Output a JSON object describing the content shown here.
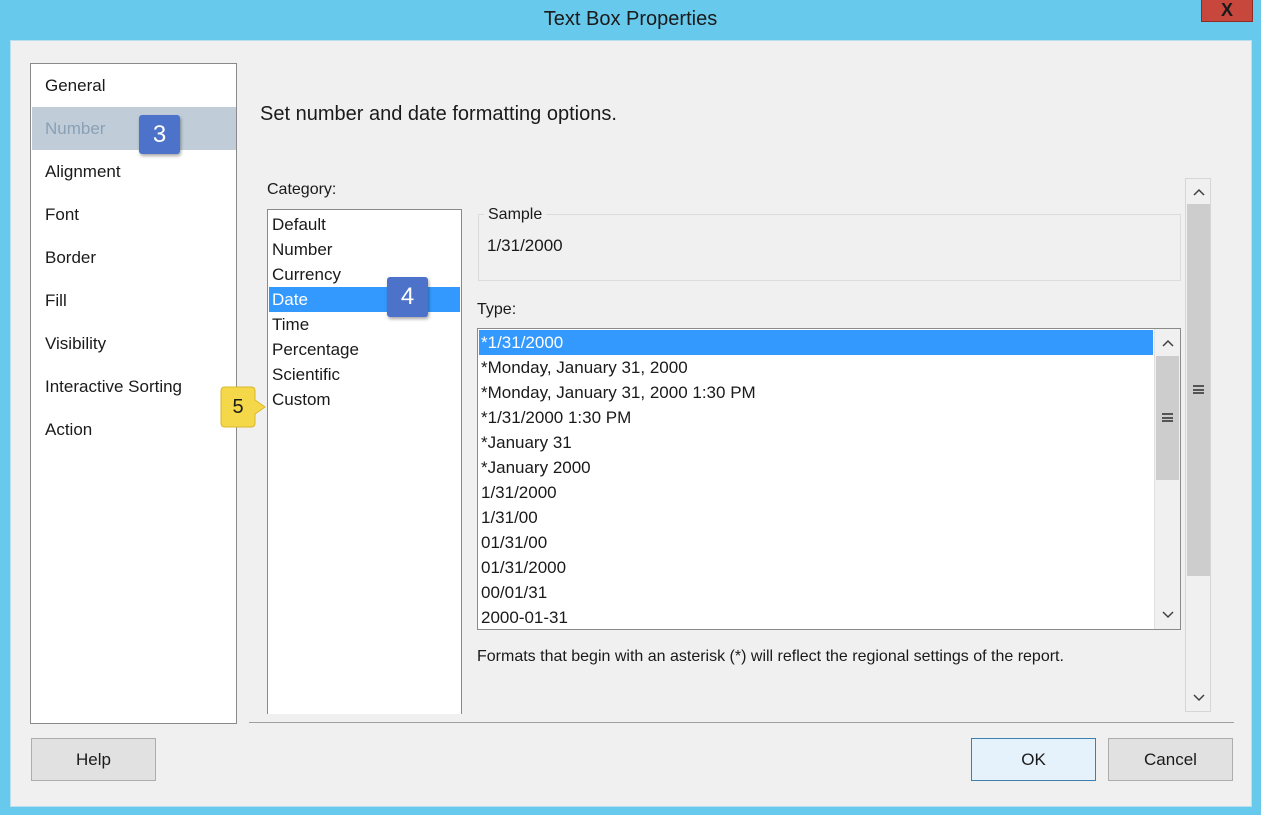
{
  "window": {
    "title": "Text Box Properties",
    "close_label": "X"
  },
  "nav": {
    "items": [
      {
        "label": "General"
      },
      {
        "label": "Number"
      },
      {
        "label": "Alignment"
      },
      {
        "label": "Font"
      },
      {
        "label": "Border"
      },
      {
        "label": "Fill"
      },
      {
        "label": "Visibility"
      },
      {
        "label": "Interactive Sorting"
      },
      {
        "label": "Action"
      }
    ],
    "selected": "Number"
  },
  "callouts": {
    "step3": "3",
    "step4": "4",
    "step5": "5"
  },
  "main": {
    "heading": "Set number and date formatting options.",
    "category_label": "Category:",
    "categories": [
      "Default",
      "Number",
      "Currency",
      "Date",
      "Time",
      "Percentage",
      "Scientific",
      "Custom"
    ],
    "selected_category": "Date",
    "sample_label": "Sample",
    "sample_value": "1/31/2000",
    "type_label": "Type:",
    "types": [
      "*1/31/2000",
      "*Monday, January 31, 2000",
      "*Monday, January 31, 2000 1:30 PM",
      "*1/31/2000 1:30 PM",
      "*January 31",
      "*January 2000",
      "1/31/2000",
      "1/31/00",
      "01/31/00",
      "01/31/2000",
      "00/01/31",
      "2000-01-31"
    ],
    "selected_type": "*1/31/2000",
    "footnote": "Formats that begin with an asterisk (*) will reflect the regional settings of the report."
  },
  "buttons": {
    "help": "Help",
    "ok": "OK",
    "cancel": "Cancel"
  },
  "icons": {
    "scroll_up": "chevron-up-icon",
    "scroll_down": "chevron-down-icon",
    "scroll_grip": "grip-icon"
  },
  "colors": {
    "titlebar": "#67c9ec",
    "selection": "#3399ff",
    "nav_selected": "#c0cdd9",
    "callout_blue": "#4c73c9",
    "callout_yellow": "#f5d84a",
    "close": "#c8473d"
  }
}
